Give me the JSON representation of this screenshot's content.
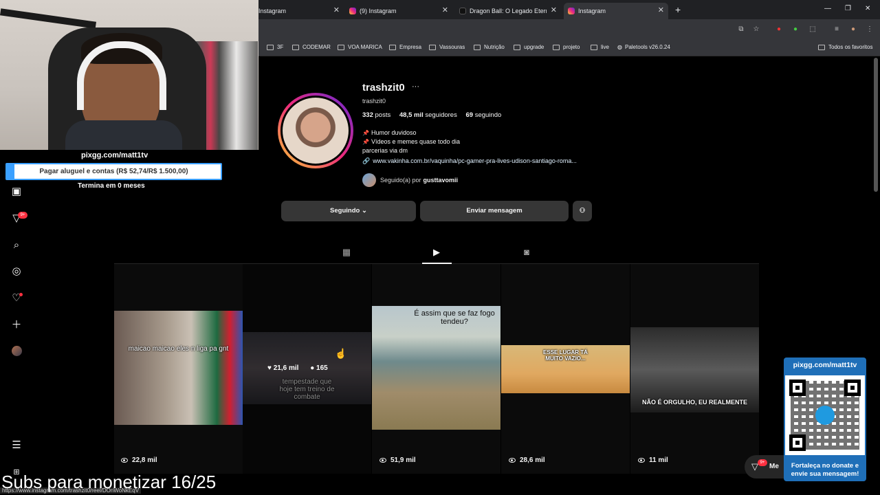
{
  "browser": {
    "tabs": [
      {
        "label": "Instagram",
        "icon": "instagram-icon"
      },
      {
        "label": "(9) Instagram",
        "icon": "instagram-icon"
      },
      {
        "label": "Dragon Ball: O Legado Eterno c",
        "icon": "tiktok-icon"
      },
      {
        "label": "Instagram",
        "icon": "instagram-icon"
      }
    ],
    "bookmarks": [
      "3F",
      "CODEMAR",
      "VOA MARICA",
      "Empresa",
      "Vassouras",
      "Nutrição",
      "upgrade",
      "projeto",
      "live",
      "Paletools v26.0.24"
    ],
    "all_bookmarks": "Todos os favoritos",
    "status_url": "https://www.instagram.com/trashzit0/reel/DOnWoNkEqV"
  },
  "stream": {
    "link": "pixgg.com/matt1tv",
    "goal_text": "Pagar aluguel e contas (R$ 52,74/R$ 1.500,00)",
    "goal_progress": 0.035,
    "goal_end": "Termina em 0 meses",
    "subs_text": "Subs para monetizar 16/25",
    "qr_title": "pixgg.com/matt1tv",
    "qr_footer_1": "Fortaleça no donate e",
    "qr_footer_2": "envie sua mensagem!",
    "accent": "#1f6fb8"
  },
  "nav": {
    "badge": "9+",
    "messages_badge": "9+",
    "messages_label": "Me"
  },
  "profile": {
    "username": "trashzit0",
    "handle": "trashzit0",
    "posts_count": "332",
    "posts_label": "posts",
    "followers_count": "48,5 mil",
    "followers_label": "seguidores",
    "following_count": "69",
    "following_label": "seguindo",
    "bio_line1": "Humor duvidoso",
    "bio_line2": "Vídeos e memes quase todo dia",
    "bio_line3": "parcerias via dm",
    "link": "www.vakinha.com.br/vaquinha/pc-gamer-pra-lives-udison-santiago-roma...",
    "followed_by_label": "Seguido(a) por",
    "followed_by_user": "gusttavomii",
    "following_button": "Seguindo",
    "message_button": "Enviar mensagem"
  },
  "reels": [
    {
      "caption": "maicao maicao eles n liga pa gnt",
      "views": "22,8 mil"
    },
    {
      "caption": "tempestade que hoje tem treino de combate",
      "likes": "21,6 mil",
      "comments": "165"
    },
    {
      "caption": "É assim que se faz fogo tendeu?",
      "views": "51,9 mil"
    },
    {
      "caption": "ESSE LUGAR TÁ MUITO VAZIO...",
      "views": "28,6 mil"
    },
    {
      "caption": "NÃO É ORGULHO, EU REALMENTE",
      "views": "11 mil"
    }
  ]
}
